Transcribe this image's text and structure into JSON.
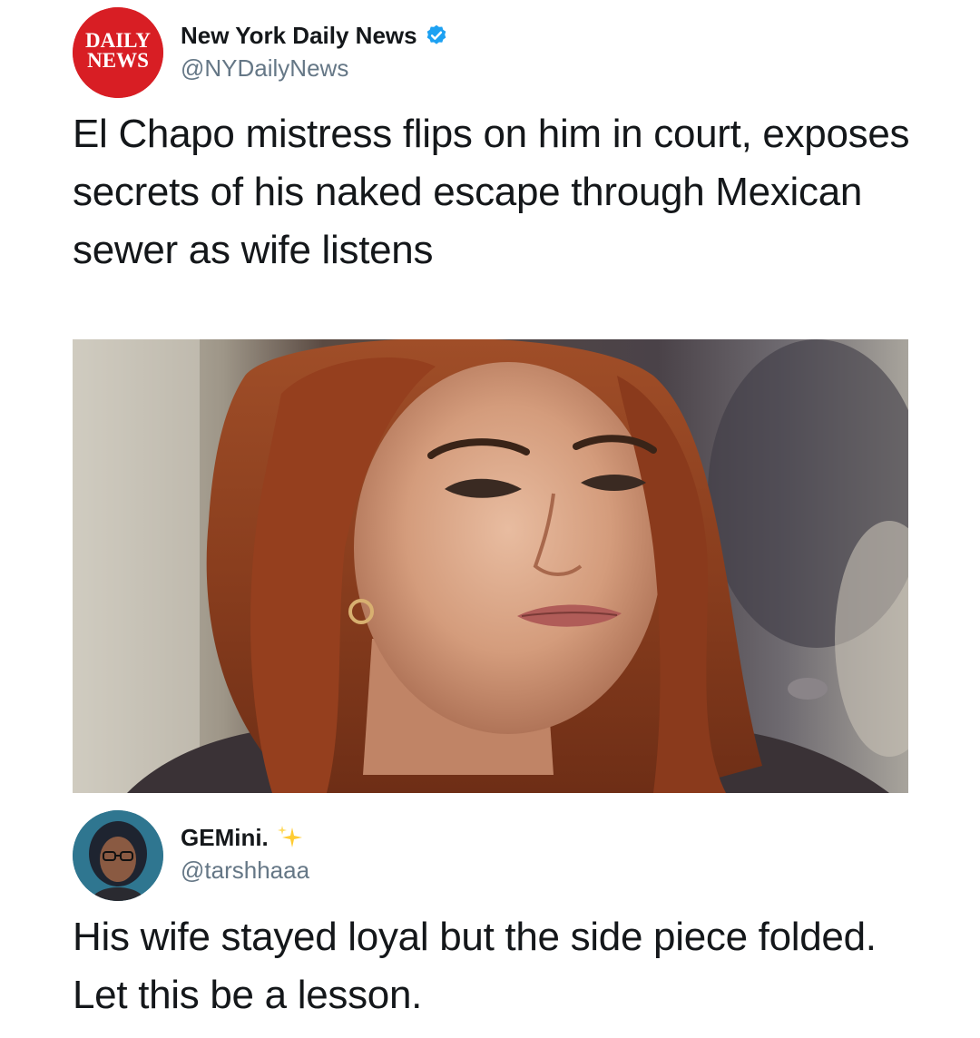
{
  "tweets": [
    {
      "display_name": "New York Daily News",
      "handle": "@NYDailyNews",
      "verified": true,
      "avatar_icon": "daily-news-logo-icon",
      "avatar_logo_text": [
        "DAILY",
        "NEWS"
      ],
      "text": "El Chapo mistress flips on him in court, exposes secrets of his naked escape through Mexican sewer as wife listens",
      "has_media": true,
      "media_icon": "woman-portrait-photo"
    },
    {
      "display_name": "GEMini.",
      "handle": "@tarshhaaa",
      "name_emoji": "sparkles-icon",
      "avatar_icon": "user-avatar-photo",
      "text": "His wife stayed loyal but the side piece folded. Let this be a lesson."
    }
  ],
  "colors": {
    "brand_red": "#d81e24",
    "verified_blue": "#1da1f2",
    "handle_gray": "#657786",
    "text": "#14171a"
  }
}
